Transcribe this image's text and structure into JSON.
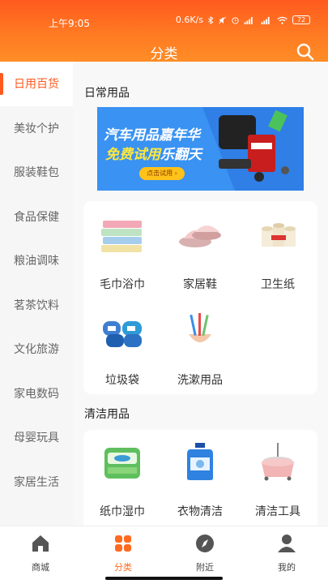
{
  "status": {
    "time": "上午9:05",
    "speed": "0.6K/s",
    "battery": "72"
  },
  "header": {
    "title": "分类",
    "search_icon": "search-icon"
  },
  "sidebar": {
    "items": [
      {
        "label": "日用百货",
        "active": true
      },
      {
        "label": "美妆个护"
      },
      {
        "label": "服装鞋包"
      },
      {
        "label": "食品保健"
      },
      {
        "label": "粮油调味"
      },
      {
        "label": "茗茶饮料"
      },
      {
        "label": "文化旅游"
      },
      {
        "label": "家电数码"
      },
      {
        "label": "母婴玩具"
      },
      {
        "label": "家居生活"
      }
    ]
  },
  "main": {
    "section1": {
      "title": "日常用品",
      "banner": {
        "headline": "汽车用品嘉年华",
        "subline1": "免费试用",
        "subline2": "乐翻天",
        "cta": "点击试用"
      },
      "items": [
        {
          "label": "毛巾浴巾",
          "icon": "towel-icon"
        },
        {
          "label": "家居鞋",
          "icon": "slipper-icon"
        },
        {
          "label": "卫生纸",
          "icon": "tissue-roll-icon"
        },
        {
          "label": "垃圾袋",
          "icon": "trash-bag-icon"
        },
        {
          "label": "洗漱用品",
          "icon": "toothbrush-icon"
        }
      ]
    },
    "section2": {
      "title": "清洁用品",
      "items": [
        {
          "label": "纸巾湿巾",
          "icon": "wet-wipes-icon"
        },
        {
          "label": "衣物清洁",
          "icon": "detergent-icon"
        },
        {
          "label": "清洁工具",
          "icon": "mop-bucket-icon"
        }
      ]
    }
  },
  "nav": {
    "items": [
      {
        "label": "商城",
        "icon": "home-icon"
      },
      {
        "label": "分类",
        "icon": "category-icon",
        "active": true
      },
      {
        "label": "附近",
        "icon": "compass-icon"
      },
      {
        "label": "我的",
        "icon": "user-icon"
      }
    ]
  },
  "colors": {
    "accent": "#ff5a1f",
    "header_gradient_end": "#ff8d27"
  }
}
